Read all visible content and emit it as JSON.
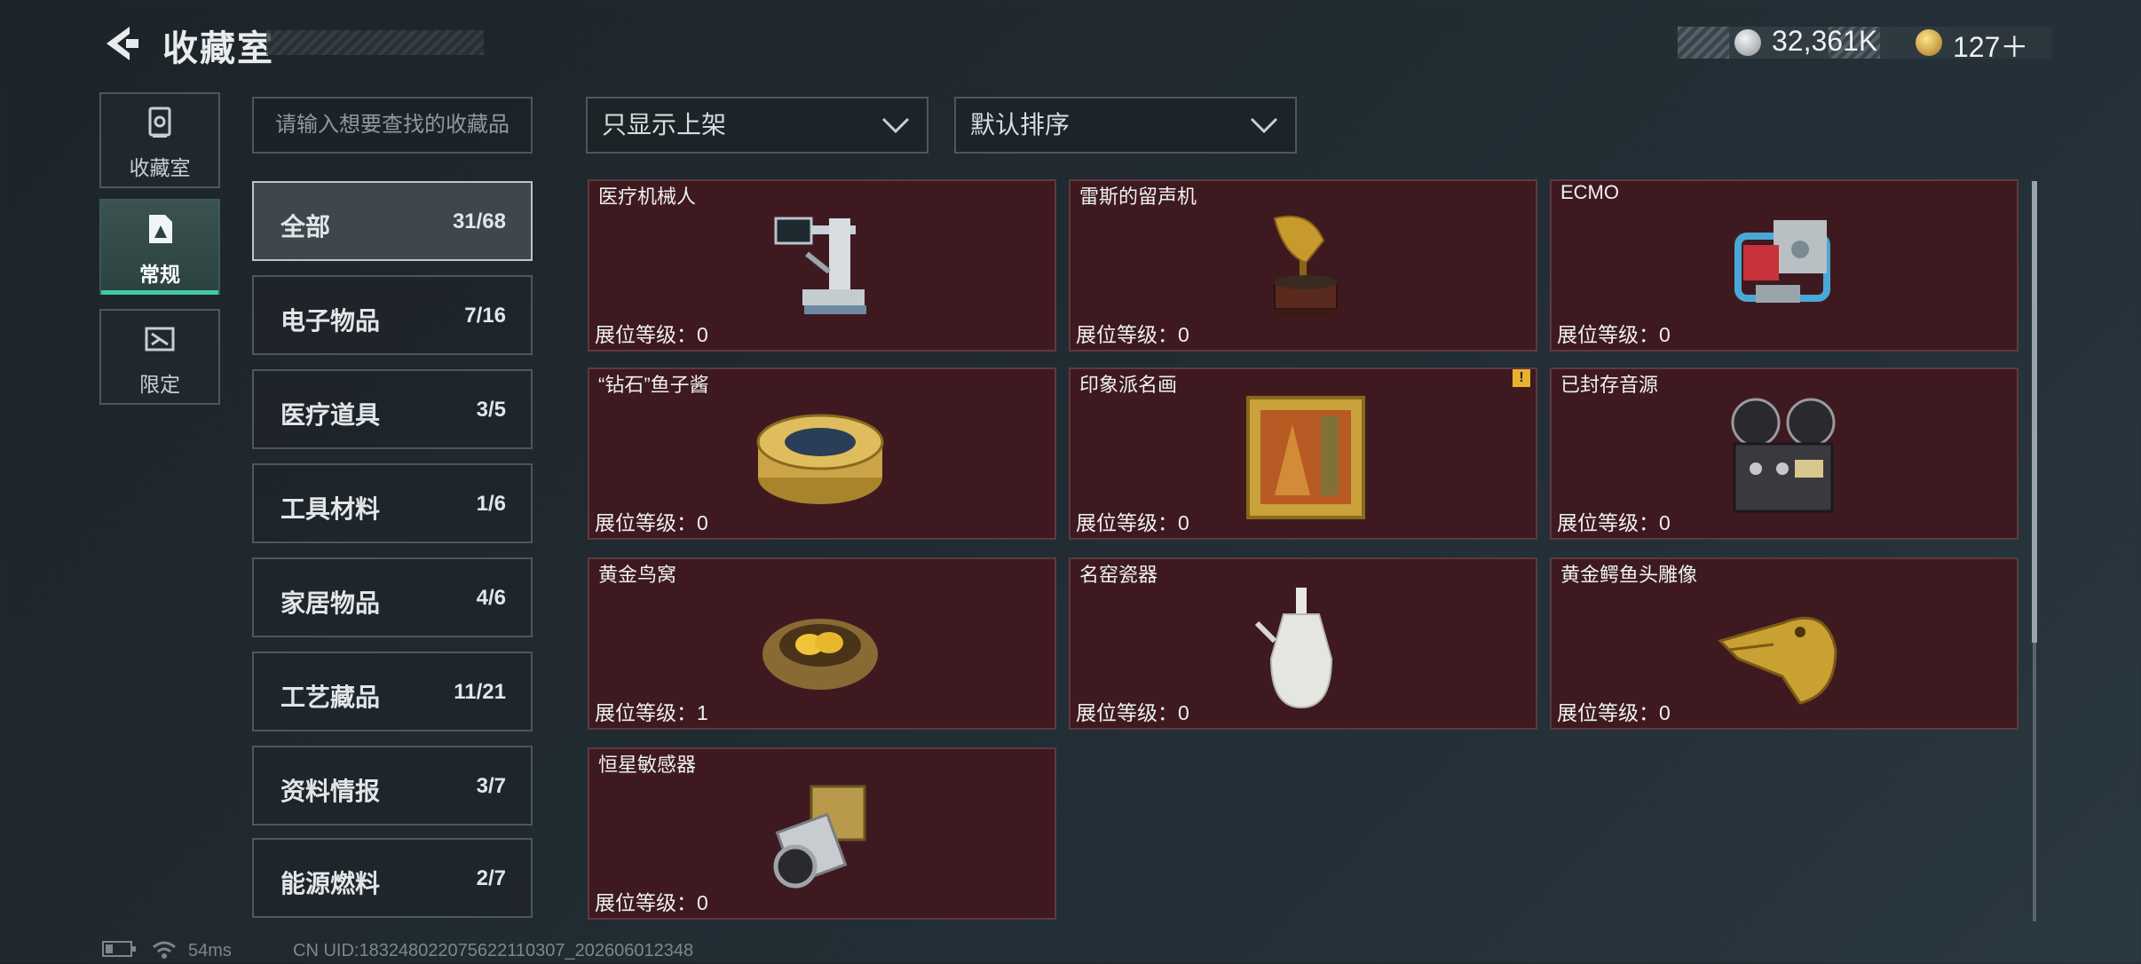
{
  "header": {
    "title": "收藏室"
  },
  "currency": [
    {
      "icon": "silver-coin-icon",
      "value": "32,361K"
    },
    {
      "icon": "gold-coin-icon",
      "value": "127＋"
    }
  ],
  "side_nav": [
    {
      "label": "收藏室",
      "icon": "vault-icon"
    },
    {
      "label": "常规",
      "icon": "card-icon",
      "active": true
    },
    {
      "label": "限定",
      "icon": "ticket-icon"
    }
  ],
  "search": {
    "placeholder": "请输入想要查找的收藏品"
  },
  "filters": {
    "shelf": "只显示上架",
    "sort": "默认排序"
  },
  "categories": [
    {
      "label": "全部",
      "count": "31/68",
      "active": true
    },
    {
      "label": "电子物品",
      "count": "7/16"
    },
    {
      "label": "医疗道具",
      "count": "3/5"
    },
    {
      "label": "工具材料",
      "count": "1/6"
    },
    {
      "label": "家居物品",
      "count": "4/6"
    },
    {
      "label": "工艺藏品",
      "count": "11/21"
    },
    {
      "label": "资料情报",
      "count": "3/7"
    },
    {
      "label": "能源燃料",
      "count": "2/7"
    }
  ],
  "level_label": "展位等级：",
  "items": [
    {
      "name": "医疗机械人",
      "level": "0",
      "icon": "medical-robot-icon"
    },
    {
      "name": "雷斯的留声机",
      "level": "0",
      "icon": "gramophone-icon"
    },
    {
      "name": "ECMO",
      "level": "0",
      "icon": "ecmo-machine-icon"
    },
    {
      "name": "“钻石”鱼子酱",
      "level": "0",
      "icon": "caviar-tin-icon"
    },
    {
      "name": "印象派名画",
      "level": "0",
      "icon": "framed-painting-icon",
      "warning": "!"
    },
    {
      "name": "已封存音源",
      "level": "0",
      "icon": "reel-recorder-icon"
    },
    {
      "name": "黄金鸟窝",
      "level": "1",
      "icon": "golden-nest-icon"
    },
    {
      "name": "名窑瓷器",
      "level": "0",
      "icon": "porcelain-vase-icon"
    },
    {
      "name": "黄金鳄鱼头雕像",
      "level": "0",
      "icon": "gold-crocodile-icon"
    },
    {
      "name": "恒星敏感器",
      "level": "0",
      "icon": "star-sensor-icon"
    }
  ],
  "status": {
    "ping": "54ms",
    "uid": "CN UID:183248022075622110307_202606012348"
  }
}
